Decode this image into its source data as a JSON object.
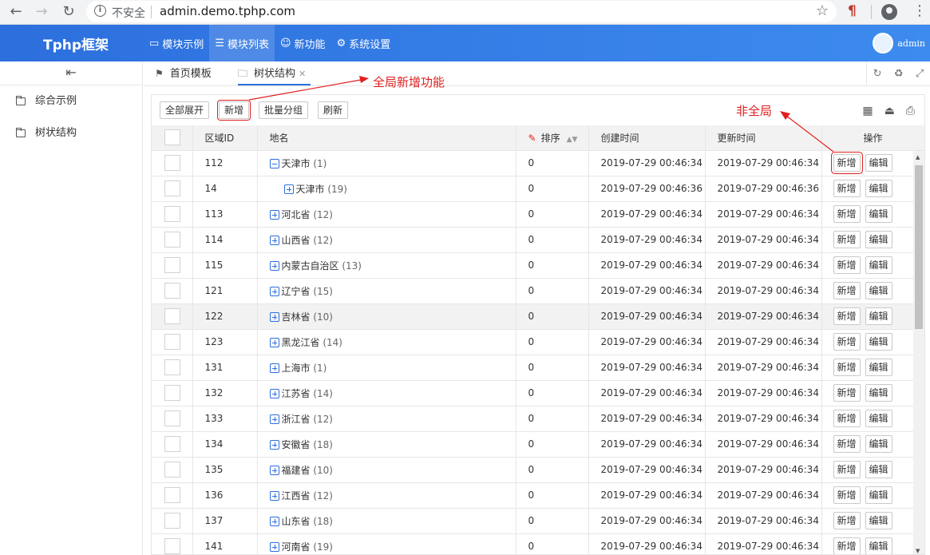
{
  "browser": {
    "security_label": "不安全",
    "url": "admin.demo.tphp.com"
  },
  "header": {
    "brand": "Tphp框架",
    "nav": [
      {
        "label": "模块示例",
        "icon": "monitor-icon",
        "active": false
      },
      {
        "label": "模块列表",
        "icon": "list-icon",
        "active": true
      },
      {
        "label": "新功能",
        "icon": "smile-icon",
        "active": false
      },
      {
        "label": "系统设置",
        "icon": "gear-icon",
        "active": false
      }
    ],
    "user": "admin"
  },
  "sidebar": {
    "items": [
      {
        "label": "综合示例"
      },
      {
        "label": "树状结构"
      }
    ]
  },
  "tabs": [
    {
      "label": "首页模板",
      "icon": "flag-icon"
    },
    {
      "label": "树状结构",
      "icon": "folder-icon",
      "active": true
    }
  ],
  "annotations": {
    "global": "全局新增功能",
    "local": "非全局"
  },
  "toolbar": {
    "expand_all": "全部展开",
    "add": "新增",
    "batch_group": "批量分组",
    "refresh": "刷新"
  },
  "table": {
    "headers": {
      "id": "区域ID",
      "name": "地名",
      "sort": "排序",
      "created": "创建时间",
      "updated": "更新时间",
      "ops": "操作"
    },
    "row_actions": {
      "add": "新增",
      "edit": "编辑"
    },
    "rows": [
      {
        "id": "112",
        "name": "天津市",
        "count": "(1)",
        "sort": "0",
        "created": "2019-07-29 00:46:34",
        "updated": "2019-07-29 00:46:34",
        "expanded": true,
        "level": 0
      },
      {
        "id": "14",
        "name": "天津市",
        "count": "(19)",
        "sort": "0",
        "created": "2019-07-29 00:46:36",
        "updated": "2019-07-29 00:46:36",
        "expanded": false,
        "level": 1
      },
      {
        "id": "113",
        "name": "河北省",
        "count": "(12)",
        "sort": "0",
        "created": "2019-07-29 00:46:34",
        "updated": "2019-07-29 00:46:34",
        "expanded": false,
        "level": 0
      },
      {
        "id": "114",
        "name": "山西省",
        "count": "(12)",
        "sort": "0",
        "created": "2019-07-29 00:46:34",
        "updated": "2019-07-29 00:46:34",
        "expanded": false,
        "level": 0
      },
      {
        "id": "115",
        "name": "内蒙古自治区",
        "count": "(13)",
        "sort": "0",
        "created": "2019-07-29 00:46:34",
        "updated": "2019-07-29 00:46:34",
        "expanded": false,
        "level": 0
      },
      {
        "id": "121",
        "name": "辽宁省",
        "count": "(15)",
        "sort": "0",
        "created": "2019-07-29 00:46:34",
        "updated": "2019-07-29 00:46:34",
        "expanded": false,
        "level": 0
      },
      {
        "id": "122",
        "name": "吉林省",
        "count": "(10)",
        "sort": "0",
        "created": "2019-07-29 00:46:34",
        "updated": "2019-07-29 00:46:34",
        "expanded": false,
        "level": 0,
        "hover": true
      },
      {
        "id": "123",
        "name": "黑龙江省",
        "count": "(14)",
        "sort": "0",
        "created": "2019-07-29 00:46:34",
        "updated": "2019-07-29 00:46:34",
        "expanded": false,
        "level": 0
      },
      {
        "id": "131",
        "name": "上海市",
        "count": "(1)",
        "sort": "0",
        "created": "2019-07-29 00:46:34",
        "updated": "2019-07-29 00:46:34",
        "expanded": false,
        "level": 0
      },
      {
        "id": "132",
        "name": "江苏省",
        "count": "(14)",
        "sort": "0",
        "created": "2019-07-29 00:46:34",
        "updated": "2019-07-29 00:46:34",
        "expanded": false,
        "level": 0
      },
      {
        "id": "133",
        "name": "浙江省",
        "count": "(12)",
        "sort": "0",
        "created": "2019-07-29 00:46:34",
        "updated": "2019-07-29 00:46:34",
        "expanded": false,
        "level": 0
      },
      {
        "id": "134",
        "name": "安徽省",
        "count": "(18)",
        "sort": "0",
        "created": "2019-07-29 00:46:34",
        "updated": "2019-07-29 00:46:34",
        "expanded": false,
        "level": 0
      },
      {
        "id": "135",
        "name": "福建省",
        "count": "(10)",
        "sort": "0",
        "created": "2019-07-29 00:46:34",
        "updated": "2019-07-29 00:46:34",
        "expanded": false,
        "level": 0
      },
      {
        "id": "136",
        "name": "江西省",
        "count": "(12)",
        "sort": "0",
        "created": "2019-07-29 00:46:34",
        "updated": "2019-07-29 00:46:34",
        "expanded": false,
        "level": 0
      },
      {
        "id": "137",
        "name": "山东省",
        "count": "(18)",
        "sort": "0",
        "created": "2019-07-29 00:46:34",
        "updated": "2019-07-29 00:46:34",
        "expanded": false,
        "level": 0
      },
      {
        "id": "141",
        "name": "河南省",
        "count": "(19)",
        "sort": "0",
        "created": "2019-07-29 00:46:34",
        "updated": "2019-07-29 00:46:34",
        "expanded": false,
        "level": 0
      }
    ]
  }
}
